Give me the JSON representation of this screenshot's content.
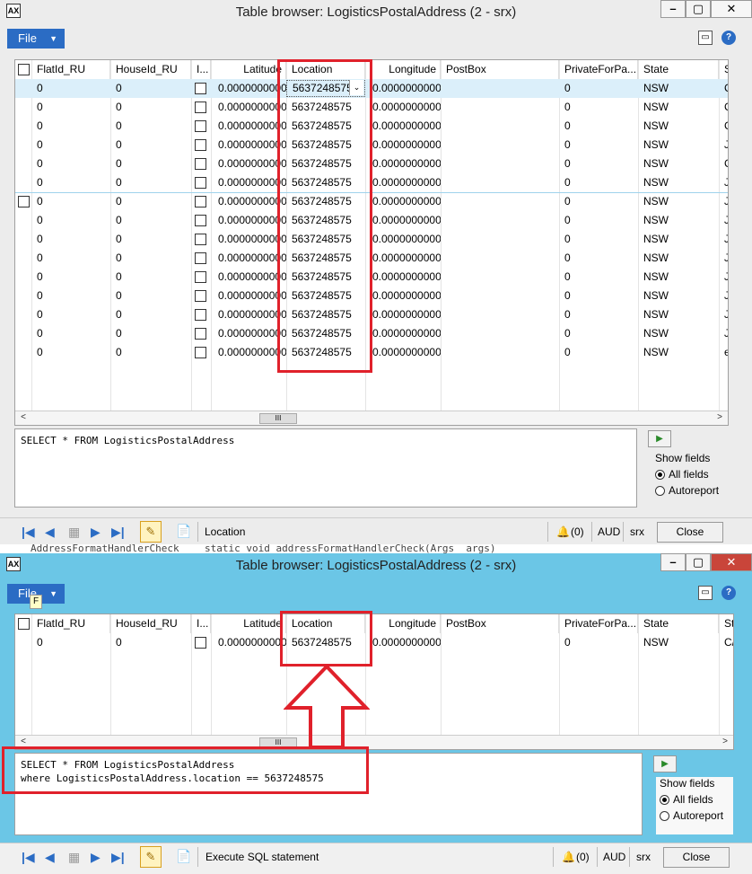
{
  "windows": [
    {
      "title": "Table browser: LogisticsPostalAddress (2 - srx)",
      "file_label": "File",
      "columns": [
        "FlatId_RU",
        "HouseId_RU",
        "I...",
        "Latitude",
        "Location",
        "Longitude",
        "PostBox",
        "PrivateForPa...",
        "State",
        "S"
      ],
      "rows": [
        {
          "flat": "0",
          "house": "0",
          "lat": "0.0000000000",
          "loc": "5637248575",
          "lon": "0.0000000000",
          "priv": "0",
          "state": "NSW",
          "s": "C"
        },
        {
          "flat": "0",
          "house": "0",
          "lat": "0.0000000000",
          "loc": "5637248575",
          "lon": "0.0000000000",
          "priv": "0",
          "state": "NSW",
          "s": "C"
        },
        {
          "flat": "0",
          "house": "0",
          "lat": "0.0000000000",
          "loc": "5637248575",
          "lon": "0.0000000000",
          "priv": "0",
          "state": "NSW",
          "s": "C"
        },
        {
          "flat": "0",
          "house": "0",
          "lat": "0.0000000000",
          "loc": "5637248575",
          "lon": "0.0000000000",
          "priv": "0",
          "state": "NSW",
          "s": "J"
        },
        {
          "flat": "0",
          "house": "0",
          "lat": "0.0000000000",
          "loc": "5637248575",
          "lon": "0.0000000000",
          "priv": "0",
          "state": "NSW",
          "s": "C"
        },
        {
          "flat": "0",
          "house": "0",
          "lat": "0.0000000000",
          "loc": "5637248575",
          "lon": "0.0000000000",
          "priv": "0",
          "state": "NSW",
          "s": "J"
        },
        {
          "flat": "0",
          "house": "0",
          "lat": "0.0000000000",
          "loc": "5637248575",
          "lon": "0.0000000000",
          "priv": "0",
          "state": "NSW",
          "s": "J"
        },
        {
          "flat": "0",
          "house": "0",
          "lat": "0.0000000000",
          "loc": "5637248575",
          "lon": "0.0000000000",
          "priv": "0",
          "state": "NSW",
          "s": "J"
        },
        {
          "flat": "0",
          "house": "0",
          "lat": "0.0000000000",
          "loc": "5637248575",
          "lon": "0.0000000000",
          "priv": "0",
          "state": "NSW",
          "s": "J"
        },
        {
          "flat": "0",
          "house": "0",
          "lat": "0.0000000000",
          "loc": "5637248575",
          "lon": "0.0000000000",
          "priv": "0",
          "state": "NSW",
          "s": "J"
        },
        {
          "flat": "0",
          "house": "0",
          "lat": "0.0000000000",
          "loc": "5637248575",
          "lon": "0.0000000000",
          "priv": "0",
          "state": "NSW",
          "s": "J"
        },
        {
          "flat": "0",
          "house": "0",
          "lat": "0.0000000000",
          "loc": "5637248575",
          "lon": "0.0000000000",
          "priv": "0",
          "state": "NSW",
          "s": "J"
        },
        {
          "flat": "0",
          "house": "0",
          "lat": "0.0000000000",
          "loc": "5637248575",
          "lon": "0.0000000000",
          "priv": "0",
          "state": "NSW",
          "s": "J"
        },
        {
          "flat": "0",
          "house": "0",
          "lat": "0.0000000000",
          "loc": "5637248575",
          "lon": "0.0000000000",
          "priv": "0",
          "state": "NSW",
          "s": "J"
        },
        {
          "flat": "0",
          "house": "0",
          "lat": "0.0000000000",
          "loc": "5637248575",
          "lon": "0.0000000000",
          "priv": "0",
          "state": "NSW",
          "s": "e"
        }
      ],
      "sql": [
        "SELECT * FROM LogisticsPostalAddress"
      ],
      "show_fields": "Show fields",
      "all_fields": "All fields",
      "autoreport": "Autoreport",
      "status_text": "Location",
      "alerts": "(0)",
      "currency": "AUD",
      "company": "srx",
      "close": "Close"
    },
    {
      "title": "Table browser: LogisticsPostalAddress (2 - srx)",
      "file_label": "File",
      "tooltip_key": "F",
      "columns": [
        "FlatId_RU",
        "HouseId_RU",
        "I...",
        "Latitude",
        "Location",
        "Longitude",
        "PostBox",
        "PrivateForPa...",
        "State",
        "St"
      ],
      "rows": [
        {
          "flat": "0",
          "house": "0",
          "lat": "0.0000000000",
          "loc": "5637248575",
          "lon": "0.0000000000",
          "priv": "0",
          "state": "NSW",
          "s": "C/"
        }
      ],
      "sql": [
        "SELECT * FROM LogisticsPostalAddress",
        "where LogisticsPostalAddress.location == 5637248575"
      ],
      "show_fields": "Show fields",
      "all_fields": "All fields",
      "autoreport": "Autoreport",
      "status_text": "Execute SQL statement",
      "alerts": "(0)",
      "currency": "AUD",
      "company": "srx",
      "close": "Close"
    }
  ],
  "background_code": "static void addressFormatHandlerCheck(Args _args)",
  "background_code_left": "AddressFormatHandlerCheck",
  "colors": {
    "highlight": "#e0212b",
    "accent": "#2b6cc4",
    "active_titlebar": "#6bc6e6"
  }
}
